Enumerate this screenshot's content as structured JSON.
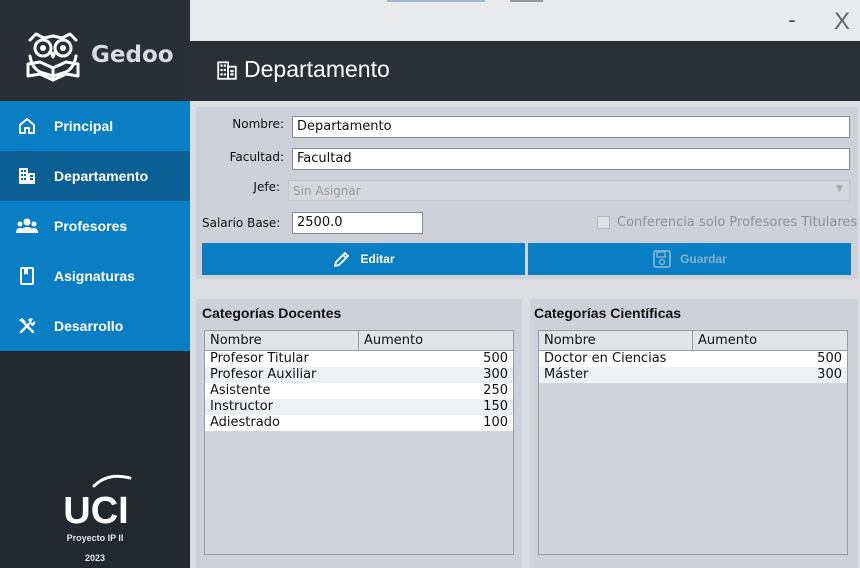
{
  "app": {
    "name": "Gedoo"
  },
  "window": {
    "minimize": "-",
    "close": "X"
  },
  "sidebar": {
    "items": [
      {
        "label": "Principal",
        "icon": "home-icon",
        "active": false
      },
      {
        "label": "Departamento",
        "icon": "building-icon",
        "active": true
      },
      {
        "label": "Profesores",
        "icon": "users-icon",
        "active": false
      },
      {
        "label": "Asignaturas",
        "icon": "book-icon",
        "active": false
      },
      {
        "label": "Desarrollo",
        "icon": "tools-icon",
        "active": false
      }
    ],
    "footer": {
      "logo": "UCI",
      "project": "Proyecto IP II",
      "year": "2023"
    }
  },
  "header": {
    "title": "Departamento",
    "icon": "building-icon"
  },
  "form": {
    "nombre_label": "Nombre:",
    "nombre_value": "Departamento",
    "facultad_label": "Facultad:",
    "facultad_value": "Facultad",
    "jefe_label": "Jefe:",
    "jefe_value": "Sin Asignar",
    "salario_label": "Salario Base:",
    "salario_value": "2500.0",
    "conferencia_label": "Conferencia solo Profesores Titulares",
    "conferencia_checked": false,
    "editar_label": "Editar",
    "guardar_label": "Guardar"
  },
  "docentes": {
    "title": "Categorías Docentes",
    "columns": [
      "Nombre",
      "Aumento"
    ],
    "rows": [
      [
        "Profesor Titular",
        "500"
      ],
      [
        "Profesor Auxiliar",
        "300"
      ],
      [
        "Asistente",
        "250"
      ],
      [
        "Instructor",
        "150"
      ],
      [
        "Adiestrado",
        "100"
      ]
    ]
  },
  "cientificas": {
    "title": "Categorías Científicas",
    "columns": [
      "Nombre",
      "Aumento"
    ],
    "rows": [
      [
        "Doctor en Ciencias",
        "500"
      ],
      [
        "Máster",
        "300"
      ]
    ]
  },
  "colors": {
    "accent": "#0a7ec2",
    "accent_active": "#0b5f94",
    "sidebar": "#23272e",
    "header": "#2b2f36"
  }
}
